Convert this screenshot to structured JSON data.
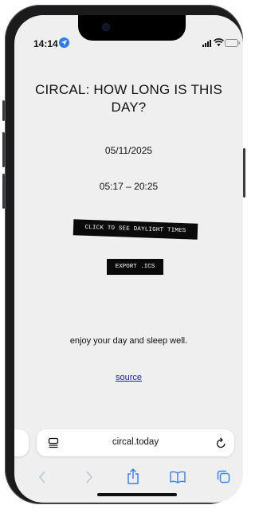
{
  "status_bar": {
    "time": "14:14"
  },
  "page": {
    "title": "CIRCAL: HOW LONG IS THIS DAY?",
    "date": "05/11/2025",
    "daylight_range": "05:17 – 20:25",
    "daylight_button_label": "CLICK TO SEE DAYLIGHT TIMES",
    "export_button_label": "EXPORT .ICS",
    "tagline": "enjoy your day and sleep well.",
    "source_link": "source"
  },
  "browser": {
    "url": "circal.today"
  },
  "colors": {
    "page_background": "#efefef",
    "button_background": "#0a0a0a",
    "link": "#1a19d6",
    "toolbar_blue": "#3b82f6",
    "location_blue": "#2f7bf0"
  }
}
